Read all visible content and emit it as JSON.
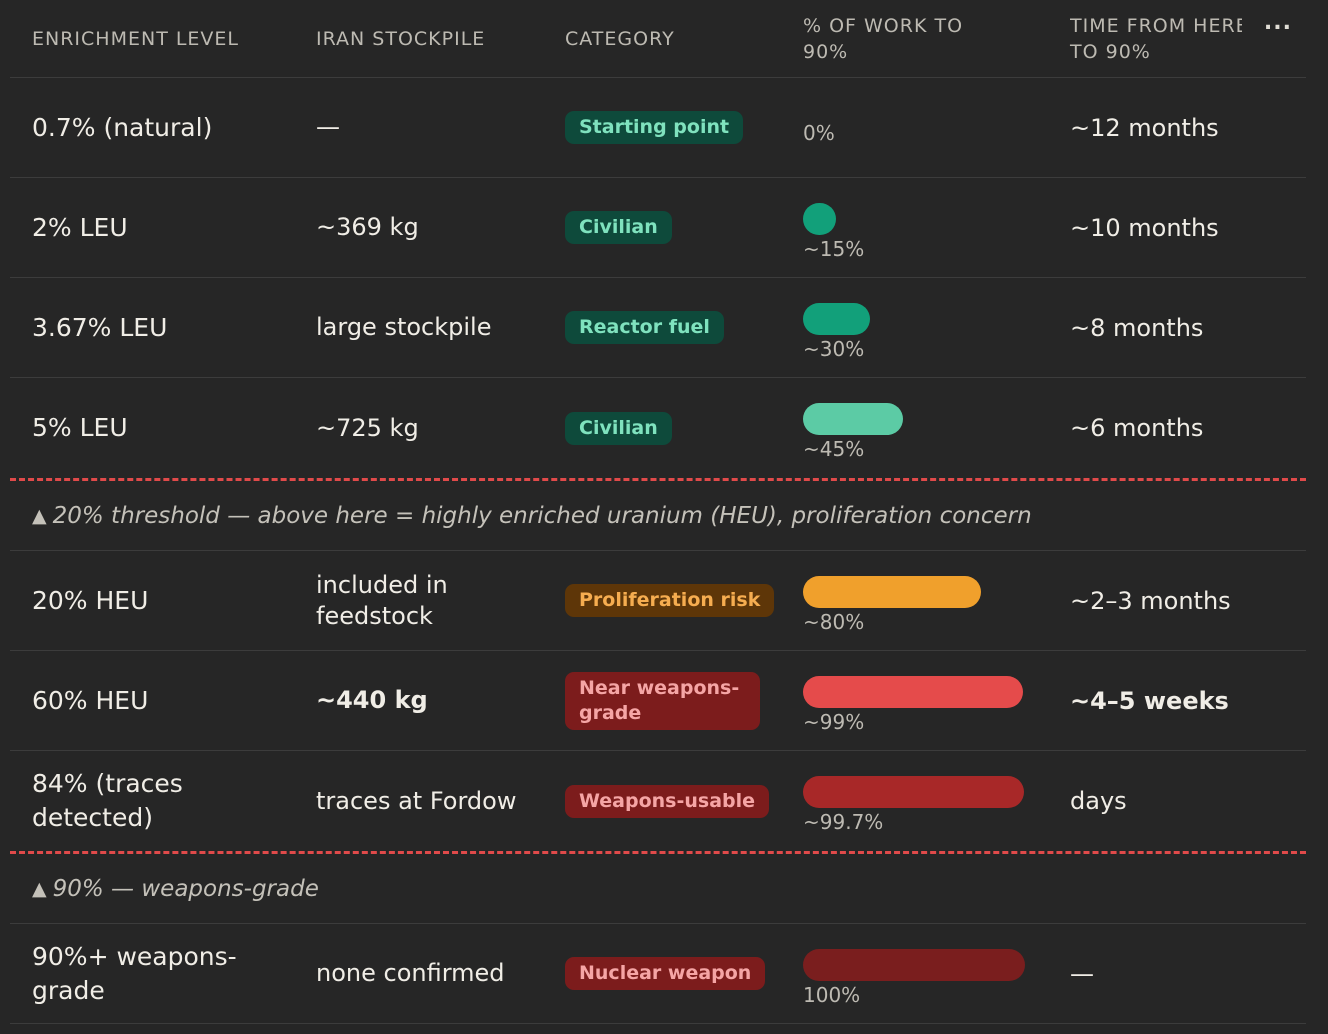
{
  "columns": {
    "enrichment": "ENRICHMENT LEVEL",
    "stockpile": "IRAN STOCKPILE",
    "category": "CATEGORY",
    "work_line1": "% OF WORK TO",
    "work_line2": "90%",
    "time_line1": "TIME FROM HERE",
    "time_line2": "TO 90%",
    "more": "..."
  },
  "rows": [
    {
      "level": "0.7% (natural)",
      "stockpile": "—",
      "category": "Starting point",
      "pct_label": "0%",
      "progress": 0,
      "time": "~12 months",
      "bar_color": "#12a07a"
    },
    {
      "level": "2% LEU",
      "stockpile": "~369 kg",
      "category": "Civilian",
      "pct_label": "~15%",
      "progress": 15,
      "time": "~10 months",
      "bar_color": "#12a07a"
    },
    {
      "level": "3.67% LEU",
      "stockpile": "large stockpile",
      "category": "Reactor fuel",
      "pct_label": "~30%",
      "progress": 30,
      "time": "~8 months",
      "bar_color": "#12a07a"
    },
    {
      "level": "5% LEU",
      "stockpile": "~725 kg",
      "category": "Civilian",
      "pct_label": "~45%",
      "progress": 45,
      "time": "~6 months",
      "bar_color": "#5ccba5"
    },
    {
      "level": "20% HEU",
      "stockpile": "included in feedstock",
      "category": "Proliferation risk",
      "pct_label": "~80%",
      "progress": 80,
      "time": "~2–3 months",
      "bar_color": "#f0a02c"
    },
    {
      "level": "60% HEU",
      "stockpile": "~440 kg",
      "category": "Near weapons-grade",
      "pct_label": "~99%",
      "progress": 99,
      "time": "~4–5 weeks",
      "bar_color": "#e54b4b"
    },
    {
      "level": "84% (traces detected)",
      "stockpile": "traces at Fordow",
      "category": "Weapons-usable",
      "pct_label": "~99.7%",
      "progress": 99.7,
      "time": "days",
      "bar_color": "#a82828"
    },
    {
      "level": "90%+ weapons-grade",
      "stockpile": "none confirmed",
      "category": "Nuclear weapon",
      "pct_label": "100%",
      "progress": 100,
      "time": "—",
      "bar_color": "#7a1e1e"
    }
  ],
  "thresholds": {
    "heu": "20% threshold — above here = highly enriched uranium (HEU), proliferation concern",
    "weapons": "90% — weapons-grade",
    "triangle": "▲"
  },
  "colors": {
    "background": "#262626",
    "threshold_line": "#e04a4a"
  }
}
